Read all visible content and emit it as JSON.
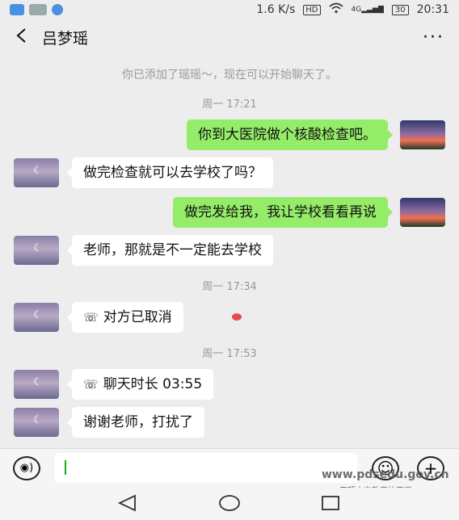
{
  "status_bar": {
    "speed": "1.6 K/s",
    "hd": "HD",
    "network": "4G",
    "battery": "30",
    "time": "20:31"
  },
  "header": {
    "title": "吕梦瑶",
    "more": "···"
  },
  "chat": {
    "system_notice": "你已添加了瑶瑶～，现在可以开始聊天了。",
    "times": [
      "周一 17:21",
      "周一 17:34",
      "周一 17:53"
    ],
    "messages": [
      {
        "from": "me",
        "text": "你到大医院做个核酸检查吧。"
      },
      {
        "from": "other",
        "text": "做完检查就可以去学校了吗？"
      },
      {
        "from": "me",
        "text": "做完发给我，我让学校看看再说"
      },
      {
        "from": "other",
        "text": "老师，那就是不一定能去学校"
      },
      {
        "from": "other",
        "text": "对方已取消",
        "call": true
      },
      {
        "from": "other",
        "text": "聊天时长 03:55",
        "call": true
      },
      {
        "from": "other",
        "text": "谢谢老师，打扰了"
      }
    ]
  },
  "input_bar": {
    "voice_icon": "voice-icon",
    "emoji_icon": "emoji-icon",
    "plus_icon": "plus-icon"
  },
  "watermark": {
    "url": "www.pdsedu.gov.cn",
    "org": "平顶山市教育体育局"
  },
  "colors": {
    "out_bubble": "#95ec69",
    "in_bubble": "#ffffff",
    "background": "#ededed"
  }
}
